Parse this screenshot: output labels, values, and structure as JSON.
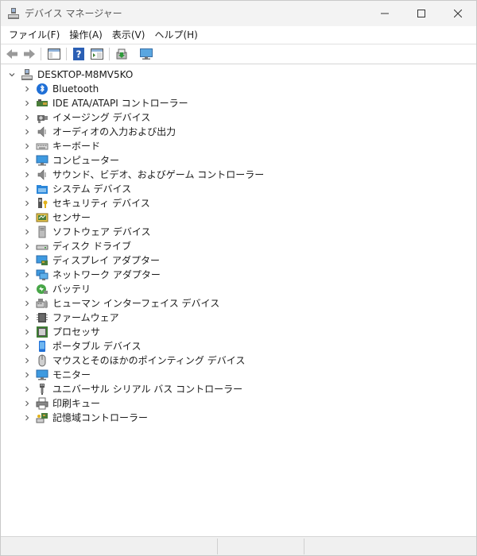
{
  "window": {
    "title": "デバイス マネージャー"
  },
  "menu": [
    {
      "label": "ファイル(F)"
    },
    {
      "label": "操作(A)"
    },
    {
      "label": "表示(V)"
    },
    {
      "label": "ヘルプ(H)"
    }
  ],
  "tree": {
    "root": "DESKTOP-M8MV5KO",
    "items": [
      {
        "label": "Bluetooth",
        "icon": "bluetooth-icon"
      },
      {
        "label": "IDE ATA/ATAPI コントローラー",
        "icon": "ide-controller-icon"
      },
      {
        "label": "イメージング デバイス",
        "icon": "camera-icon"
      },
      {
        "label": "オーディオの入力および出力",
        "icon": "speaker-icon"
      },
      {
        "label": "キーボード",
        "icon": "keyboard-icon"
      },
      {
        "label": "コンピューター",
        "icon": "computer-icon"
      },
      {
        "label": "サウンド、ビデオ、およびゲーム コントローラー",
        "icon": "speaker-icon"
      },
      {
        "label": "システム デバイス",
        "icon": "system-folder-icon"
      },
      {
        "label": "セキュリティ デバイス",
        "icon": "security-key-icon"
      },
      {
        "label": "センサー",
        "icon": "sensor-icon"
      },
      {
        "label": "ソフトウェア デバイス",
        "icon": "software-device-icon"
      },
      {
        "label": "ディスク ドライブ",
        "icon": "disk-drive-icon"
      },
      {
        "label": "ディスプレイ アダプター",
        "icon": "display-adapter-icon"
      },
      {
        "label": "ネットワーク アダプター",
        "icon": "network-adapter-icon"
      },
      {
        "label": "バッテリ",
        "icon": "battery-icon"
      },
      {
        "label": "ヒューマン インターフェイス デバイス",
        "icon": "hid-icon"
      },
      {
        "label": "ファームウェア",
        "icon": "firmware-icon"
      },
      {
        "label": "プロセッサ",
        "icon": "processor-icon"
      },
      {
        "label": "ポータブル デバイス",
        "icon": "portable-device-icon"
      },
      {
        "label": "マウスとそのほかのポインティング デバイス",
        "icon": "mouse-icon"
      },
      {
        "label": "モニター",
        "icon": "monitor-icon"
      },
      {
        "label": "ユニバーサル シリアル バス コントローラー",
        "icon": "usb-icon"
      },
      {
        "label": "印刷キュー",
        "icon": "printer-icon"
      },
      {
        "label": "記憶域コントローラー",
        "icon": "storage-controller-icon"
      }
    ]
  }
}
